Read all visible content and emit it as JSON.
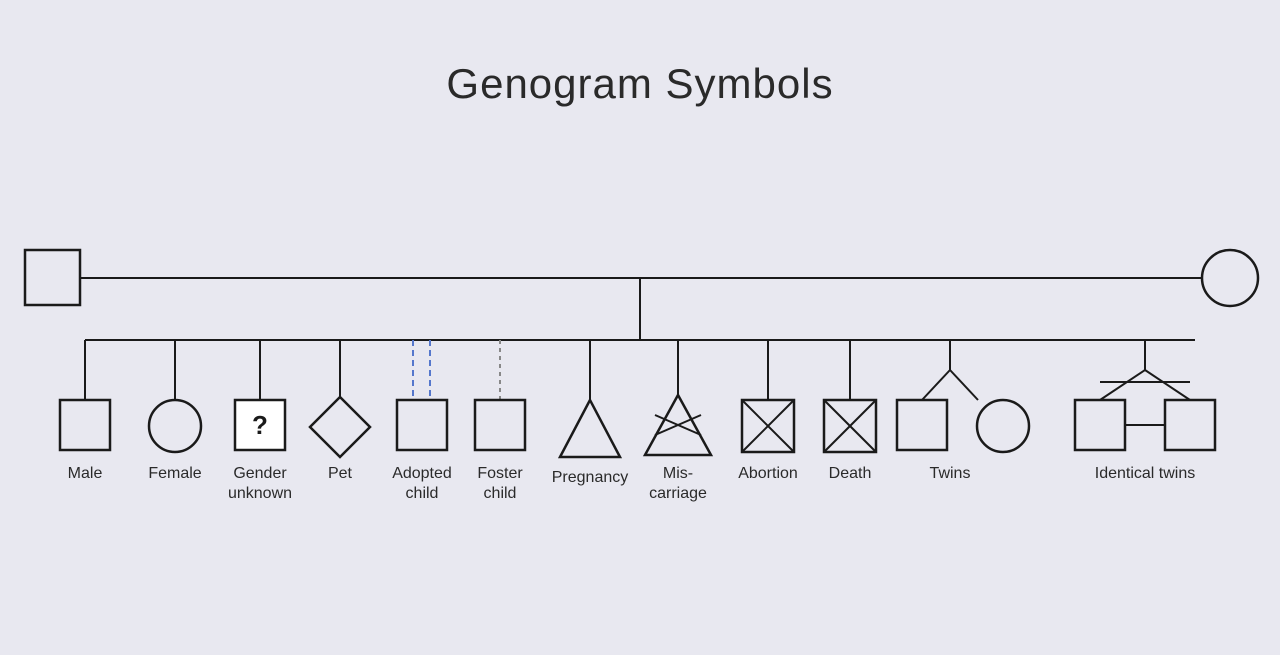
{
  "title": "Genogram Symbols",
  "symbols": [
    {
      "id": "male",
      "label": "Male"
    },
    {
      "id": "female",
      "label": "Female"
    },
    {
      "id": "gender-unknown",
      "label": "Gender unknown"
    },
    {
      "id": "pet",
      "label": "Pet"
    },
    {
      "id": "adopted-child",
      "label": "Adopted child"
    },
    {
      "id": "foster-child",
      "label": "Foster child"
    },
    {
      "id": "pregnancy",
      "label": "Pregnancy"
    },
    {
      "id": "miscarriage",
      "label": "Mis-\ncarriage"
    },
    {
      "id": "abortion",
      "label": "Abortion"
    },
    {
      "id": "death",
      "label": "Death"
    },
    {
      "id": "twins",
      "label": "Twins"
    },
    {
      "id": "identical-twins",
      "label": "Identical twins"
    }
  ],
  "colors": {
    "background": "#e8e8f0",
    "stroke": "#1a1a1a",
    "dashed_blue": "#5577cc",
    "dashed_gray": "#888888"
  }
}
